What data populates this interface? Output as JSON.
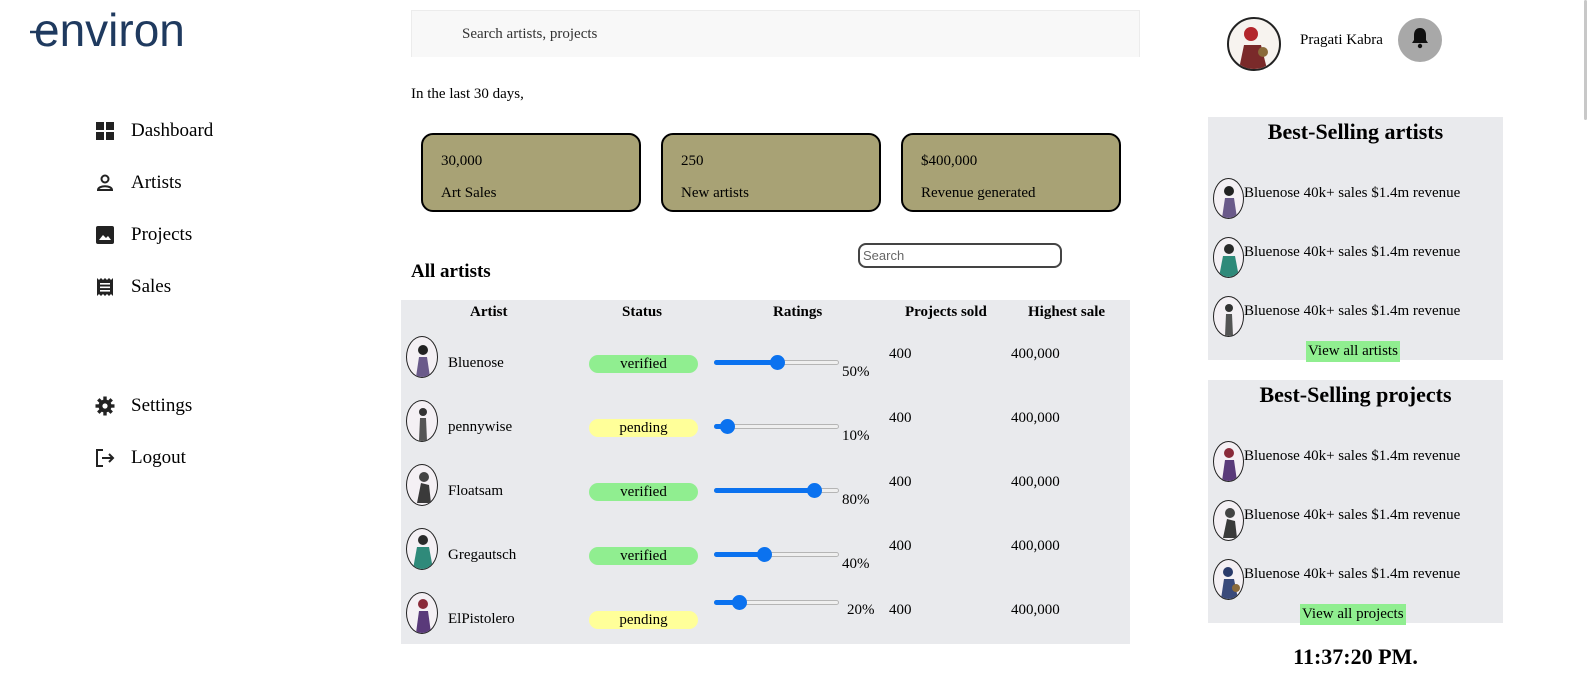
{
  "logo": {
    "text": "environ",
    "color": "#1f3a5f"
  },
  "sidebar": {
    "items": [
      {
        "label": "Dashboard",
        "icon": "dashboard-icon"
      },
      {
        "label": "Artists",
        "icon": "person-icon"
      },
      {
        "label": "Projects",
        "icon": "image-icon"
      },
      {
        "label": "Sales",
        "icon": "receipt-icon"
      }
    ],
    "bottom": [
      {
        "label": "Settings",
        "icon": "gear-icon"
      },
      {
        "label": "Logout",
        "icon": "logout-icon"
      }
    ]
  },
  "search": {
    "placeholder": "Search artists, projects"
  },
  "period_text": "In the last 30 days,",
  "stats": [
    {
      "value": "30,000",
      "label": "Art Sales"
    },
    {
      "value": "250",
      "label": "New artists"
    },
    {
      "value": "$400,000",
      "label": "Revenue generated"
    }
  ],
  "artists_section": {
    "title": "All artists",
    "search_placeholder": "Search",
    "columns": [
      "Artist",
      "Status",
      "Ratings",
      "Projects sold",
      "Highest sale"
    ],
    "rows": [
      {
        "name": "Bluenose",
        "status": "verified",
        "rating": 50,
        "rating_label": "50%",
        "projects_sold": "400",
        "highest_sale": "400,000"
      },
      {
        "name": "pennywise",
        "status": "pending",
        "rating": 10,
        "rating_label": "10%",
        "projects_sold": "400",
        "highest_sale": "400,000"
      },
      {
        "name": "Floatsam",
        "status": "verified",
        "rating": 80,
        "rating_label": "80%",
        "projects_sold": "400",
        "highest_sale": "400,000"
      },
      {
        "name": "Gregautsch",
        "status": "verified",
        "rating": 40,
        "rating_label": "40%",
        "projects_sold": "400",
        "highest_sale": "400,000"
      },
      {
        "name": "ElPistolero",
        "status": "pending",
        "rating": 20,
        "rating_label": "20%",
        "projects_sold": "400",
        "highest_sale": "400,000"
      }
    ]
  },
  "profile": {
    "name": "Pragati Kabra",
    "bell_icon": "bell-icon"
  },
  "best_artists": {
    "title": "Best-Selling artists",
    "items": [
      {
        "name": "Bluenose",
        "sales": "40k+ sales",
        "revenue": "$1.4m revenue"
      },
      {
        "name": "Bluenose",
        "sales": "40k+ sales",
        "revenue": "$1.4m revenue"
      },
      {
        "name": "Bluenose",
        "sales": "40k+ sales",
        "revenue": "$1.4m revenue"
      }
    ],
    "view_all": "View all artists"
  },
  "best_projects": {
    "title": "Best-Selling projects",
    "items": [
      {
        "name": "Bluenose",
        "sales": "40k+ sales",
        "revenue": "$1.4m revenue"
      },
      {
        "name": "Bluenose",
        "sales": "40k+ sales",
        "revenue": "$1.4m revenue"
      },
      {
        "name": "Bluenose",
        "sales": "40k+ sales",
        "revenue": "$1.4m revenue"
      }
    ],
    "view_all": "View all projects"
  },
  "clock": "11:37:20 PM.",
  "colors": {
    "stat_card": "#a8a275",
    "verified": "#90ee90",
    "pending": "#ffff99",
    "slider": "#0b72ef",
    "panel_bg": "#e9eaed",
    "view_all_bg": "#90ee90"
  }
}
